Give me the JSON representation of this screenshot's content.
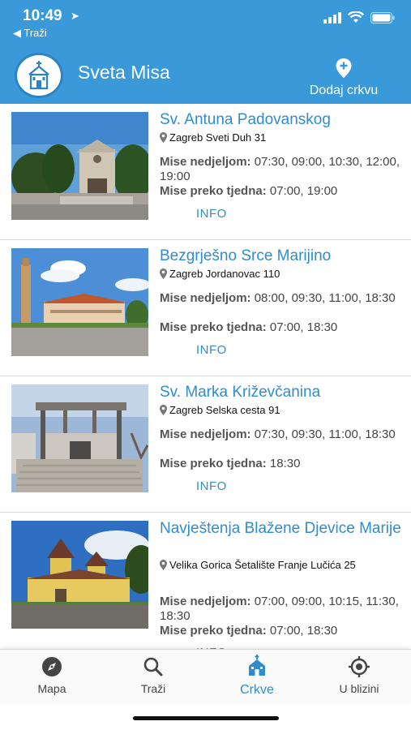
{
  "status": {
    "time": "10:49",
    "back": "◀ Traži"
  },
  "header": {
    "title": "Sveta Misa",
    "add_label": "Dodaj crkvu"
  },
  "labels": {
    "sunday": "Mise nedjeljom:",
    "weekday": "Mise preko tjedna:",
    "info": "INFO"
  },
  "churches": [
    {
      "name": "Sv. Antuna Padovanskog",
      "address": "Zagreb Sveti Duh 31",
      "sunday": " 07:30, 09:00, 10:30, 12:00, 19:00",
      "weekday": " 07:00, 19:00"
    },
    {
      "name": "Bezgrješno Srce Marijino",
      "address": "Zagreb Jordanovac 110",
      "sunday": " 08:00, 09:30, 11:00, 18:30",
      "weekday": " 07:00, 18:30"
    },
    {
      "name": "Sv. Marka Križevčanina",
      "address": "Zagreb Selska cesta 91",
      "sunday": " 07:30, 09:30, 11:00, 18:30",
      "weekday": " 18:30"
    },
    {
      "name": "Navještenja Blažene Djevice Marije",
      "address": "Velika Gorica Šetalište Franje Lučića 25",
      "sunday": " 07:00, 09:00, 10:15, 11:30, 18:30",
      "weekday": " 07:00, 18:30"
    }
  ],
  "tabs": [
    {
      "label": "Mapa",
      "icon": "compass-icon"
    },
    {
      "label": "Traži",
      "icon": "search-icon"
    },
    {
      "label": "Crkve",
      "icon": "church-icon",
      "active": true
    },
    {
      "label": "U blizini",
      "icon": "location-target-icon"
    }
  ],
  "colors": {
    "primary": "#3a9ad9",
    "link": "#2e8dcf"
  }
}
